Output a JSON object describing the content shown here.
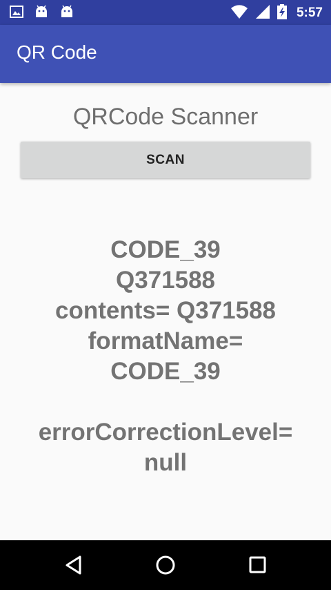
{
  "status_bar": {
    "time": "5:57",
    "icons": [
      "image-icon",
      "android-icon",
      "android-icon",
      "wifi-icon",
      "signal-icon",
      "battery-charging-icon"
    ]
  },
  "app_bar": {
    "title": "QR Code"
  },
  "main": {
    "scanner_title": "QRCode Scanner",
    "scan_button_label": "SCAN",
    "result_lines": [
      "CODE_39",
      "Q371588",
      "contents= Q371588",
      "formatName=",
      "CODE_39",
      "",
      "errorCorrectionLevel=",
      "null"
    ]
  },
  "nav_bar": {
    "icons": [
      "back-icon",
      "home-icon",
      "recents-icon"
    ]
  },
  "colors": {
    "status_bar": "#303f9f",
    "app_bar": "#3f51b5",
    "background": "#fafafa",
    "button": "#d6d7d7",
    "result_text": "#737373"
  }
}
